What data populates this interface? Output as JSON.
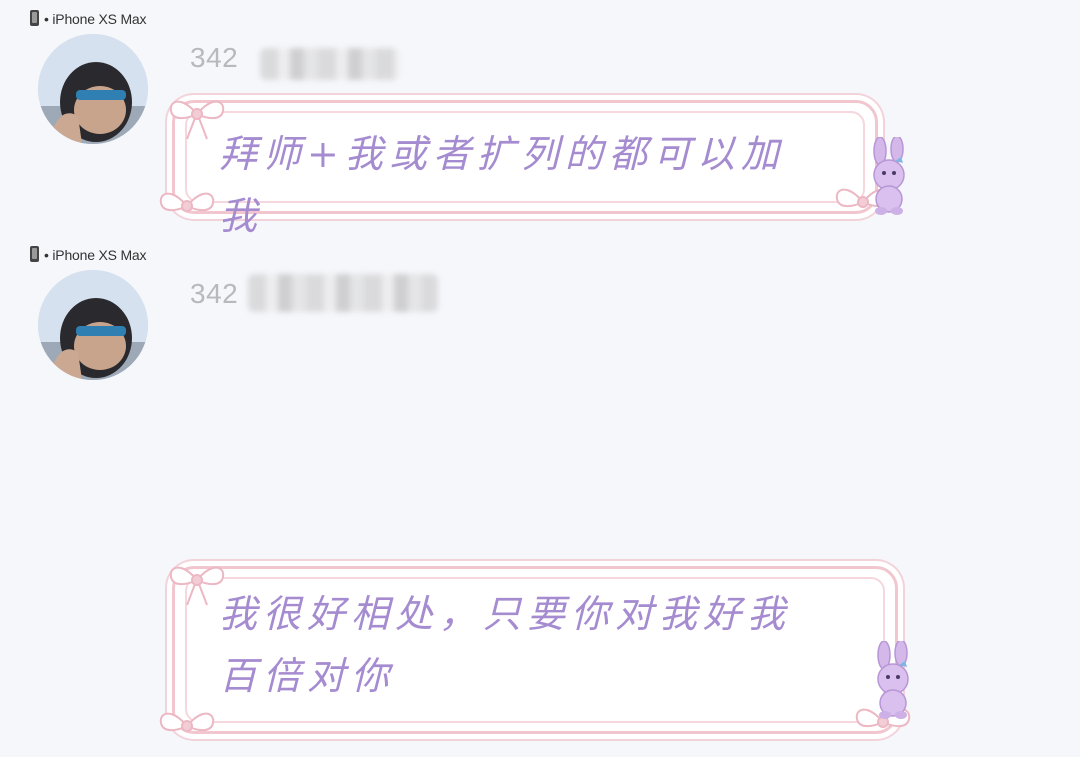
{
  "messages": [
    {
      "device": "• iPhone XS Max",
      "username": "342",
      "text": "拜师+我或者扩列的都可以加我",
      "avatar": "user-avatar"
    },
    {
      "device": "• iPhone XS Max",
      "username": "342",
      "text": "我很好相处，只要你对我好我百倍对你",
      "avatar": "user-avatar"
    }
  ],
  "colors": {
    "background": "#f6f7fb",
    "bubble_border": "#f1c6cf",
    "message_text": "#a58bd0",
    "username_text": "#b7b9bd"
  }
}
